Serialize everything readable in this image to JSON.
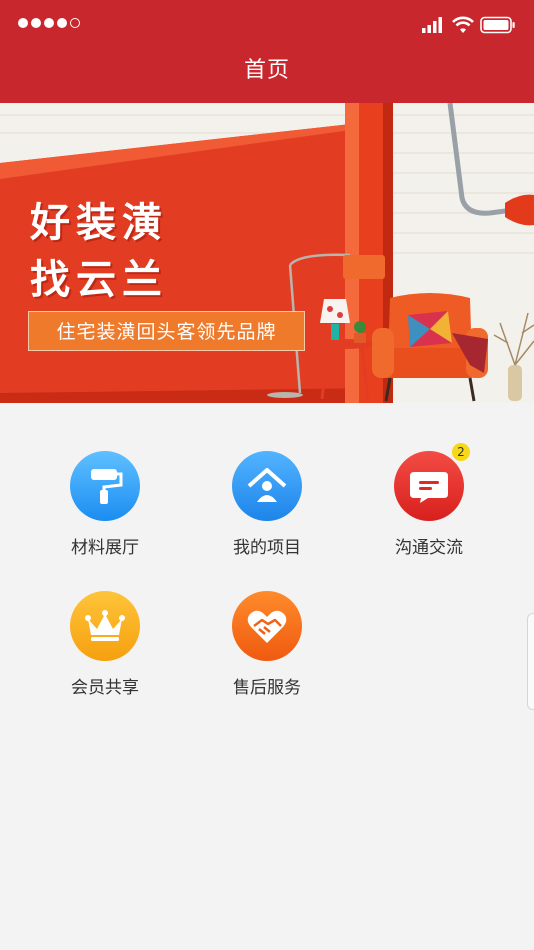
{
  "header": {
    "title": "首页"
  },
  "banner": {
    "slogan_line1": "好装潢",
    "slogan_line2": "找云兰",
    "tagline": "住宅装潢回头客领先品牌"
  },
  "menu": {
    "items": [
      {
        "label": "材料展厅",
        "icon": "paint-roller-icon",
        "color": "#2b9cf6"
      },
      {
        "label": "我的项目",
        "icon": "house-person-icon",
        "color": "#2792f2"
      },
      {
        "label": "沟通交流",
        "icon": "chat-bubble-icon",
        "color": "#e0302a",
        "badge": "2"
      },
      {
        "label": "会员共享",
        "icon": "crown-icon",
        "color": "#f8ad1e"
      },
      {
        "label": "售后服务",
        "icon": "heart-handshake-icon",
        "color": "#f36a18"
      }
    ]
  },
  "colors": {
    "header_bg": "#c8272d",
    "page_bg": "#f3f3f3",
    "badge_bg": "#f7d817"
  }
}
